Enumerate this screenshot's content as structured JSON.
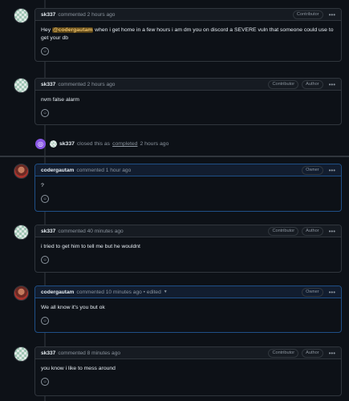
{
  "comments": [
    {
      "author": "sk337",
      "action": "commented",
      "time": "2 hours ago",
      "badges": [
        "Contributor"
      ],
      "body_before": "Hey ",
      "mention": "@codergautam",
      "body_after": " when i get home in a few hours i am dm you on discord a SEVERE vuln that someone could use to get your db"
    },
    {
      "author": "sk337",
      "action": "commented",
      "time": "2 hours ago",
      "badges": [
        "Contributor",
        "Author"
      ],
      "body": "nvm false alarm"
    },
    {
      "author": "codergautam",
      "action": "commented",
      "time": "1 hour ago",
      "badges": [
        "Owner"
      ],
      "body": "?"
    },
    {
      "author": "sk337",
      "action": "commented",
      "time": "40 minutes ago",
      "badges": [
        "Contributor",
        "Author"
      ],
      "body": "i tried to get him to tell me but he wouldnt"
    },
    {
      "author": "codergautam",
      "action": "commented",
      "time": "10 minutes ago",
      "edited": "• edited",
      "badges": [
        "Owner"
      ],
      "body": "We all know it's you but ok"
    },
    {
      "author": "sk337",
      "action": "commented",
      "time": "8 minutes ago",
      "badges": [
        "Contributor",
        "Author"
      ],
      "body": "you know i like to mess around"
    }
  ],
  "event": {
    "author": "sk337",
    "text": "closed this as",
    "link": "completed",
    "time": "2 hours ago"
  },
  "icons": {
    "more": "kebab-icon",
    "reaction": "smiley-icon",
    "closed": "check-circle-icon"
  },
  "colors": {
    "background": "#0d1117",
    "border": "#30363d",
    "owner_border": "#1f4f87",
    "closed": "#8957e5",
    "mention": "#f0c36b"
  }
}
